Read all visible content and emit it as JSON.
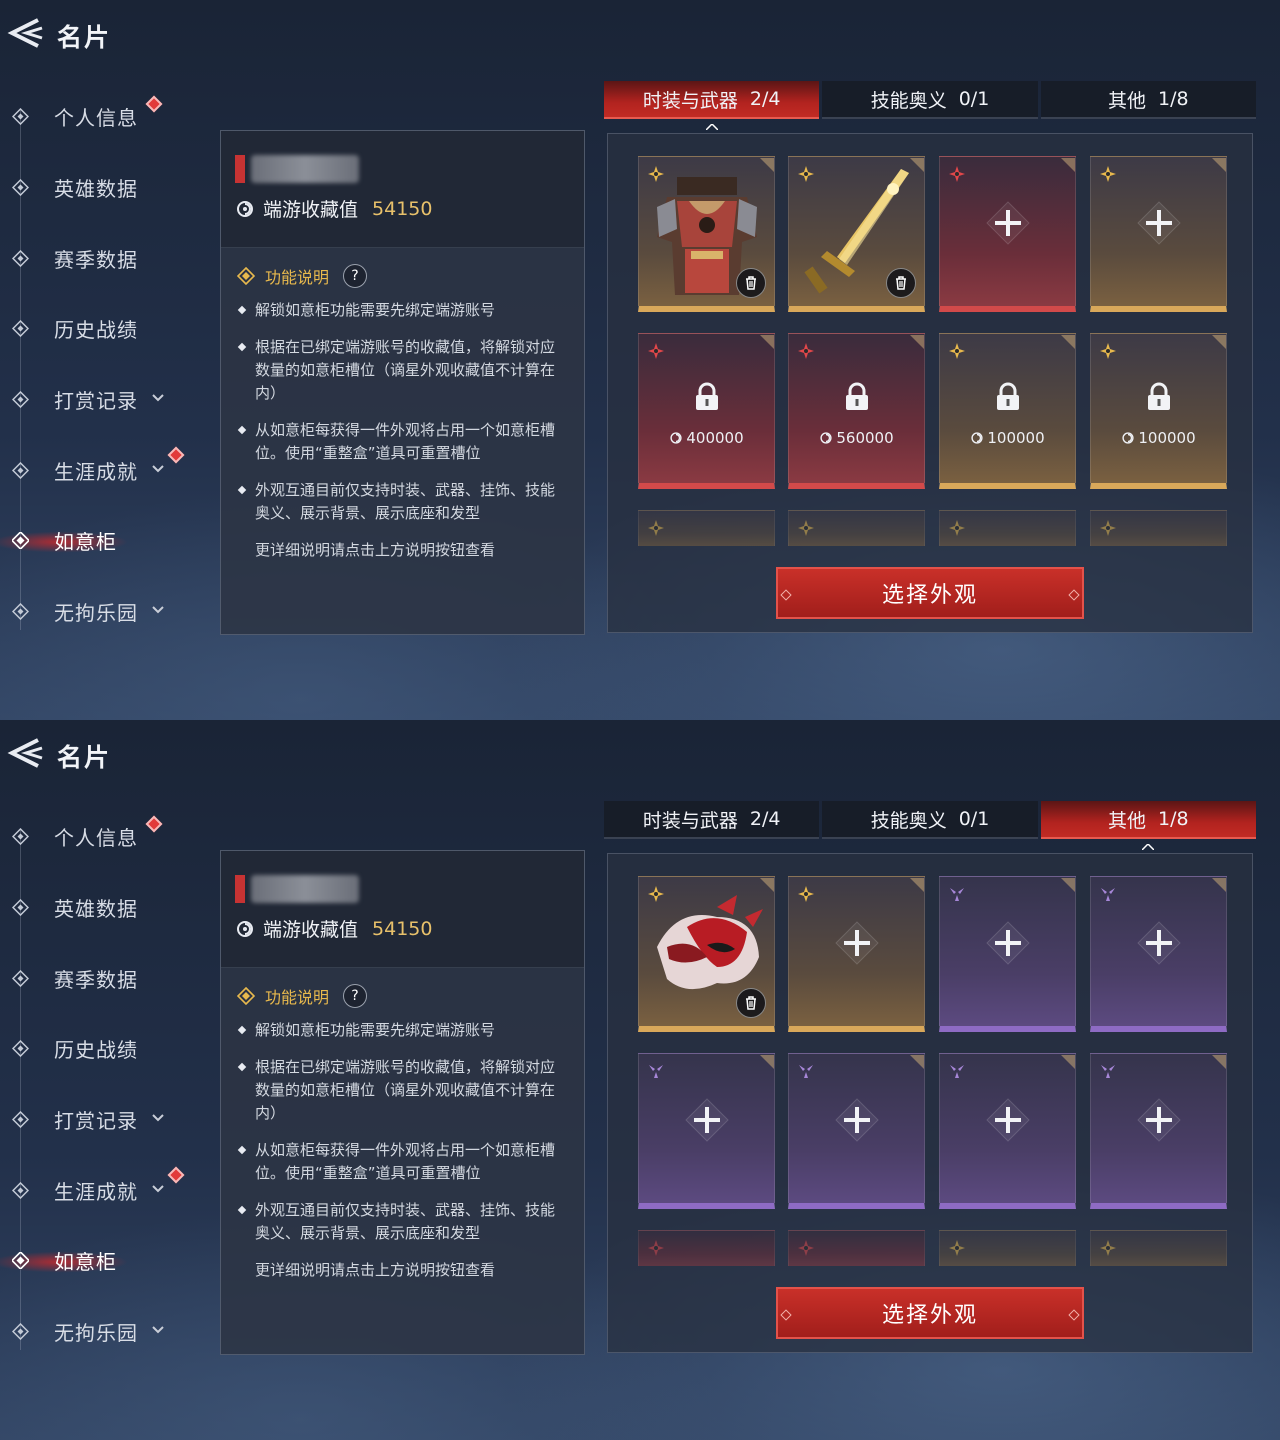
{
  "screens": [
    {
      "header": {
        "title": "名片"
      },
      "nav": [
        {
          "label": "个人信息",
          "badge": true,
          "chevron": false,
          "active": false
        },
        {
          "label": "英雄数据",
          "badge": false,
          "chevron": false,
          "active": false
        },
        {
          "label": "赛季数据",
          "badge": false,
          "chevron": false,
          "active": false
        },
        {
          "label": "历史战绩",
          "badge": false,
          "chevron": false,
          "active": false
        },
        {
          "label": "打赏记录",
          "badge": false,
          "chevron": true,
          "active": false
        },
        {
          "label": "生涯成就",
          "badge": true,
          "chevron": true,
          "active": false
        },
        {
          "label": "如意柜",
          "badge": false,
          "chevron": false,
          "active": true
        },
        {
          "label": "无拘乐园",
          "badge": false,
          "chevron": true,
          "active": false
        }
      ],
      "info": {
        "collection_label": "端游收藏值",
        "collection_value": "54150",
        "func_title": "功能说明",
        "help_icon": "?",
        "bullets": [
          "解锁如意柜功能需要先绑定端游账号",
          "根据在已绑定端游账号的收藏值，将解锁对应数量的如意柜槽位（谪星外观收藏值不计算在内）",
          "从如意柜每获得一件外观将占用一个如意柜槽位。使用“重整盒”道具可重置槽位",
          "外观互通目前仅支持时装、武器、挂饰、技能奥义、展示背景、展示底座和发型"
        ],
        "footer": "更详细说明请点击上方说明按钮查看"
      },
      "tabs": [
        {
          "label": "时装与武器",
          "count": "2/4",
          "active": true
        },
        {
          "label": "技能奥义",
          "count": "0/1",
          "active": false
        },
        {
          "label": "其他",
          "count": "1/8",
          "active": false
        }
      ],
      "slots": [
        {
          "kind": "item",
          "icon": "armor-art",
          "rarity": "gold"
        },
        {
          "kind": "item",
          "icon": "sword-art",
          "rarity": "gold"
        },
        {
          "kind": "empty",
          "rarity": "red"
        },
        {
          "kind": "empty",
          "rarity": "gold"
        },
        {
          "kind": "locked",
          "rarity": "red",
          "cost": "400000"
        },
        {
          "kind": "locked",
          "rarity": "red",
          "cost": "560000"
        },
        {
          "kind": "locked",
          "rarity": "gold",
          "cost": "100000"
        },
        {
          "kind": "locked",
          "rarity": "gold",
          "cost": "100000"
        },
        {
          "kind": "faded",
          "rarity": "gold"
        },
        {
          "kind": "faded",
          "rarity": "gold"
        },
        {
          "kind": "faded",
          "rarity": "gold"
        },
        {
          "kind": "faded",
          "rarity": "gold"
        }
      ],
      "button": "选择外观"
    },
    {
      "header": {
        "title": "名片"
      },
      "nav": [
        {
          "label": "个人信息",
          "badge": true,
          "chevron": false,
          "active": false
        },
        {
          "label": "英雄数据",
          "badge": false,
          "chevron": false,
          "active": false
        },
        {
          "label": "赛季数据",
          "badge": false,
          "chevron": false,
          "active": false
        },
        {
          "label": "历史战绩",
          "badge": false,
          "chevron": false,
          "active": false
        },
        {
          "label": "打赏记录",
          "badge": false,
          "chevron": true,
          "active": false
        },
        {
          "label": "生涯成就",
          "badge": true,
          "chevron": true,
          "active": false
        },
        {
          "label": "如意柜",
          "badge": false,
          "chevron": false,
          "active": true
        },
        {
          "label": "无拘乐园",
          "badge": false,
          "chevron": true,
          "active": false
        }
      ],
      "info": {
        "collection_label": "端游收藏值",
        "collection_value": "54150",
        "func_title": "功能说明",
        "help_icon": "?",
        "bullets": [
          "解锁如意柜功能需要先绑定端游账号",
          "根据在已绑定端游账号的收藏值，将解锁对应数量的如意柜槽位（谪星外观收藏值不计算在内）",
          "从如意柜每获得一件外观将占用一个如意柜槽位。使用“重整盒”道具可重置槽位",
          "外观互通目前仅支持时装、武器、挂饰、技能奥义、展示背景、展示底座和发型"
        ],
        "footer": "更详细说明请点击上方说明按钮查看"
      },
      "tabs": [
        {
          "label": "时装与武器",
          "count": "2/4",
          "active": false
        },
        {
          "label": "技能奥义",
          "count": "0/1",
          "active": false
        },
        {
          "label": "其他",
          "count": "1/8",
          "active": true
        }
      ],
      "slots": [
        {
          "kind": "item",
          "icon": "mask-art",
          "rarity": "gold"
        },
        {
          "kind": "empty",
          "rarity": "gold"
        },
        {
          "kind": "empty",
          "rarity": "purple"
        },
        {
          "kind": "empty",
          "rarity": "purple"
        },
        {
          "kind": "empty",
          "rarity": "purple"
        },
        {
          "kind": "empty",
          "rarity": "purple"
        },
        {
          "kind": "empty",
          "rarity": "purple"
        },
        {
          "kind": "empty",
          "rarity": "purple"
        },
        {
          "kind": "faded",
          "rarity": "red"
        },
        {
          "kind": "faded",
          "rarity": "red"
        },
        {
          "kind": "faded",
          "rarity": "gold"
        },
        {
          "kind": "faded",
          "rarity": "gold"
        }
      ],
      "button": "选择外观"
    }
  ],
  "colors": {
    "accent_red": "#c22b24",
    "gold": "#e8c16b",
    "purple": "#8e6bc4",
    "badge_red": "#e23a3a"
  }
}
